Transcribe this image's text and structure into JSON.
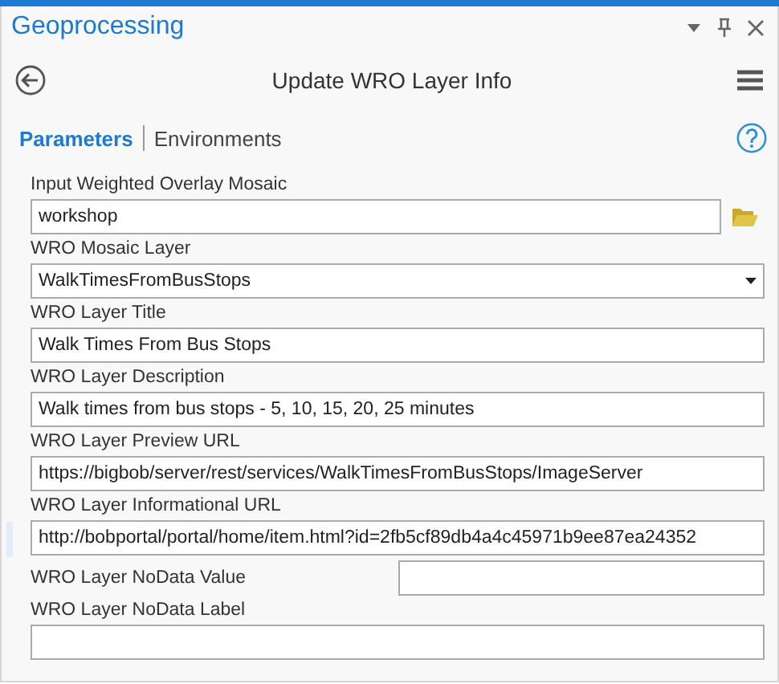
{
  "pane": {
    "title": "Geoprocessing"
  },
  "tool": {
    "title": "Update WRO Layer Info"
  },
  "tabs": [
    {
      "label": "Parameters",
      "selected": true
    },
    {
      "label": "Environments",
      "selected": false
    }
  ],
  "parameters": [
    {
      "kind": "browse",
      "label": "Input Weighted Overlay Mosaic",
      "value": "workshop",
      "focused": false
    },
    {
      "kind": "dropdown",
      "label": "WRO Mosaic Layer",
      "value": "WalkTimesFromBusStops",
      "focused": false
    },
    {
      "kind": "text",
      "label": "WRO Layer Title",
      "value": "Walk Times From Bus Stops",
      "focused": false
    },
    {
      "kind": "text",
      "label": "WRO Layer Description",
      "value": "Walk times from bus stops - 5, 10, 15, 20, 25 minutes",
      "focused": false
    },
    {
      "kind": "text",
      "label": "WRO Layer Preview URL",
      "value": "https://bigbob/server/rest/services/WalkTimesFromBusStops/ImageServer",
      "focused": false
    },
    {
      "kind": "text",
      "label": "WRO Layer Informational URL",
      "value": "http://bobportal/portal/home/item.html?id=2fb5cf89db4a4c45971b9ee87ea24352",
      "focused": true
    },
    {
      "kind": "inline",
      "label": "WRO Layer NoData Value",
      "focused": false
    },
    {
      "kind": "text",
      "label": "WRO Layer NoData Label",
      "focused": false
    }
  ]
}
